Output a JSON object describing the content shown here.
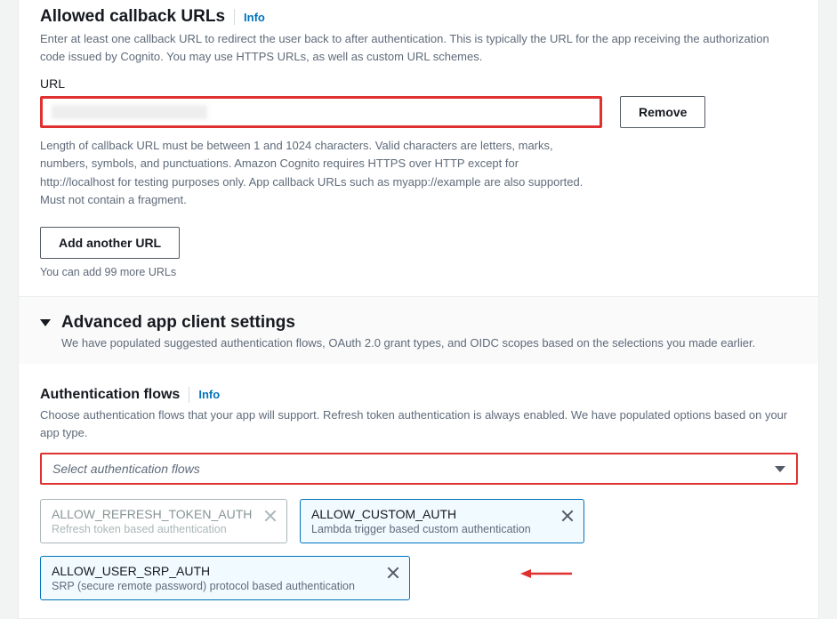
{
  "callback": {
    "title": "Allowed callback URLs",
    "info": "Info",
    "desc": "Enter at least one callback URL to redirect the user back to after authentication. This is typically the URL for the app receiving the authorization code issued by Cognito. You may use HTTPS URLs, as well as custom URL schemes.",
    "url_label": "URL",
    "remove": "Remove",
    "hint": "Length of callback URL must be between 1 and 1024 characters. Valid characters are letters, marks, numbers, symbols, and punctuations. Amazon Cognito requires HTTPS over HTTP except for http://localhost for testing purposes only. App callback URLs such as myapp://example are also supported. Must not contain a fragment.",
    "add_another": "Add another URL",
    "remaining": "You can add 99 more URLs"
  },
  "advanced": {
    "title": "Advanced app client settings",
    "desc": "We have populated suggested authentication flows, OAuth 2.0 grant types, and OIDC scopes based on the selections you made earlier."
  },
  "auth": {
    "title": "Authentication flows",
    "info": "Info",
    "desc": "Choose authentication flows that your app will support. Refresh token authentication is always enabled. We have populated options based on your app type.",
    "placeholder": "Select authentication flows",
    "chips": [
      {
        "name": "ALLOW_REFRESH_TOKEN_AUTH",
        "sub": "Refresh token based authentication",
        "state": "disabled"
      },
      {
        "name": "ALLOW_CUSTOM_AUTH",
        "sub": "Lambda trigger based custom authentication",
        "state": "active"
      },
      {
        "name": "ALLOW_USER_SRP_AUTH",
        "sub": "SRP (secure remote password) protocol based authentication",
        "state": "active"
      }
    ]
  }
}
